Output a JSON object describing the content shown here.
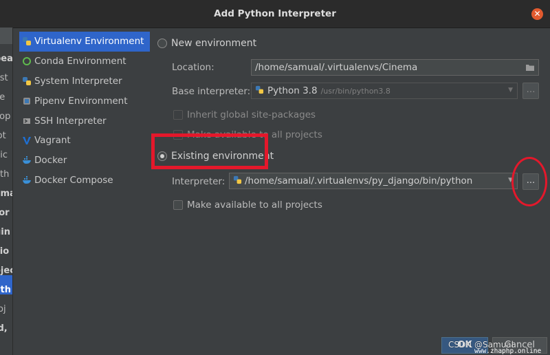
{
  "dialog": {
    "title": "Add Python Interpreter"
  },
  "left_strip": [
    "pea",
    "yst",
    "ile",
    "cop",
    "lot",
    "uic",
    "ath",
    "yma",
    "tor",
    "gin",
    "sio",
    "ojec",
    "yth",
    "roj",
    "ld,"
  ],
  "sidebar": {
    "items": [
      {
        "label": "Virtualenv Environment",
        "icon": "python-icon",
        "selected": true
      },
      {
        "label": "Conda Environment",
        "icon": "conda-icon",
        "selected": false
      },
      {
        "label": "System Interpreter",
        "icon": "python-icon",
        "selected": false
      },
      {
        "label": "Pipenv Environment",
        "icon": "pipenv-icon",
        "selected": false
      },
      {
        "label": "SSH Interpreter",
        "icon": "terminal-icon",
        "selected": false
      },
      {
        "label": "Vagrant",
        "icon": "vagrant-icon",
        "selected": false
      },
      {
        "label": "Docker",
        "icon": "docker-icon",
        "selected": false
      },
      {
        "label": "Docker Compose",
        "icon": "docker-icon",
        "selected": false
      }
    ]
  },
  "new_env": {
    "label": "New environment",
    "location_label": "Location:",
    "location_value": "/home/samual/.virtualenvs/Cinema",
    "base_label": "Base interpreter:",
    "base_value": "Python 3.8",
    "base_path": "/usr/bin/python3.8",
    "inherit_label": "Inherit global site-packages",
    "make_available_label": "Make available to all projects"
  },
  "existing_env": {
    "label": "Existing environment",
    "interpreter_label": "Interpreter:",
    "interpreter_value": "/home/samual/.virtualenvs/py_django/bin/python",
    "browse_label": "...",
    "make_available_label": "Make available to all projects"
  },
  "buttons": {
    "ok": "OK",
    "cancel": "Cancel"
  },
  "watermark": {
    "line1": "CSDN @Samual",
    "line2": "www.zhaphp.online"
  },
  "colors": {
    "selection": "#2f65ca",
    "annotation": "#e4182b",
    "close": "#e25a2f"
  }
}
